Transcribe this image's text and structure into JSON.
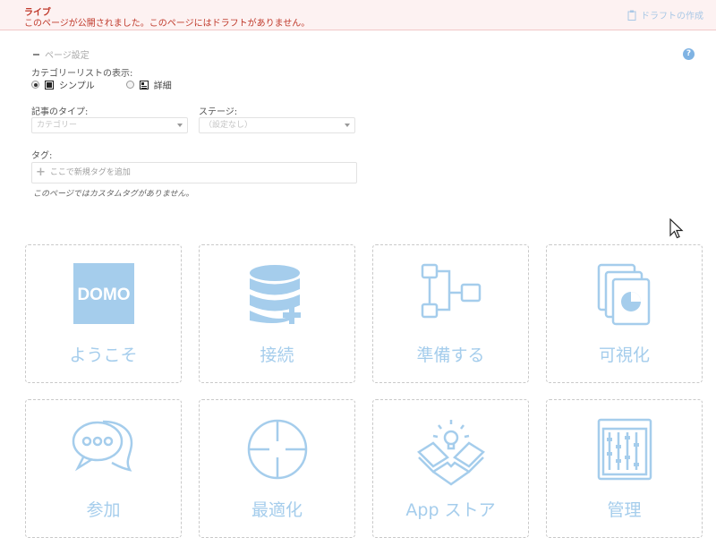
{
  "banner": {
    "title": "ライブ",
    "message": "このページが公開されました。このページにはドラフトがありません。",
    "draft_button": "ドラフトの作成"
  },
  "settings": {
    "collapse_label": "ページ設定",
    "category_display_label": "カテゴリーリストの表示:",
    "mode_simple": "シンプル",
    "mode_detail": "詳細",
    "article_type_label": "記事のタイプ:",
    "article_type_placeholder": "カテゴリー",
    "stage_label": "ステージ:",
    "stage_value": "（設定なし）",
    "tag_label": "タグ:",
    "tag_placeholder": "ここで新規タグを追加",
    "tag_note": "このページではカスタムタグがありません。"
  },
  "tiles": [
    {
      "label": "ようこそ",
      "icon": "domo-logo-icon"
    },
    {
      "label": "接続",
      "icon": "database-add-icon"
    },
    {
      "label": "準備する",
      "icon": "dataflow-icon"
    },
    {
      "label": "可視化",
      "icon": "chart-pages-icon"
    },
    {
      "label": "参加",
      "icon": "chat-bubbles-icon"
    },
    {
      "label": "最適化",
      "icon": "crosshair-icon"
    },
    {
      "label": "App ストア",
      "icon": "lightbulb-box-icon"
    },
    {
      "label": "管理",
      "icon": "sliders-icon"
    }
  ],
  "colors": {
    "icon_blue": "#a5cdec",
    "banner_red": "#c0392b",
    "banner_bg": "#fdf2f2"
  }
}
